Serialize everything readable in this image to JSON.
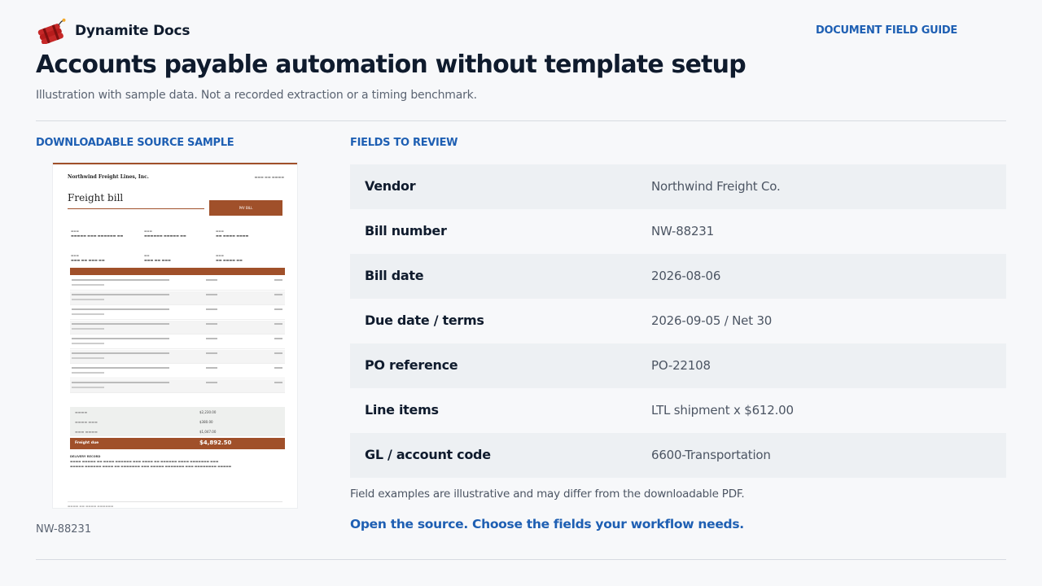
{
  "header": {
    "brand_name": "Dynamite Docs",
    "guide_link": "DOCUMENT FIELD GUIDE"
  },
  "page": {
    "title": "Accounts payable automation without template setup",
    "subtitle": "Illustration with sample data. Not a recorded extraction or a timing benchmark."
  },
  "source": {
    "section_label": "DOWNLOADABLE SOURCE SAMPLE",
    "caption": "NW-88231",
    "document": {
      "company": "Northwind Freight Lines, Inc.",
      "title": "Freight bill",
      "pay_button": "PAY BILL",
      "due_label": "Freight due",
      "due_value": "$4,892.50",
      "totals": [
        "$2,230.00",
        "$380.00",
        "$1,047.00"
      ],
      "notes_heading": "DELIVERY RECORD"
    }
  },
  "fields": {
    "section_label": "FIELDS TO REVIEW",
    "rows": [
      {
        "label": "Vendor",
        "value": "Northwind Freight Co."
      },
      {
        "label": "Bill number",
        "value": "NW-88231"
      },
      {
        "label": "Bill date",
        "value": "2026-08-06"
      },
      {
        "label": "Due date / terms",
        "value": "2026-09-05 / Net 30"
      },
      {
        "label": "PO reference",
        "value": "PO-22108"
      },
      {
        "label": "Line items",
        "value": "LTL shipment x $612.00"
      },
      {
        "label": "GL / account code",
        "value": "6600-Transportation"
      }
    ],
    "note": "Field examples are illustrative and may differ from the downloadable PDF.",
    "cta": "Open the source. Choose the fields your workflow needs."
  },
  "colors": {
    "accent": "#1e5fb3",
    "document_accent": "#a0502a",
    "row_shade": "#edf0f3"
  },
  "icons": {
    "logo": "dynamite-logo-icon"
  }
}
